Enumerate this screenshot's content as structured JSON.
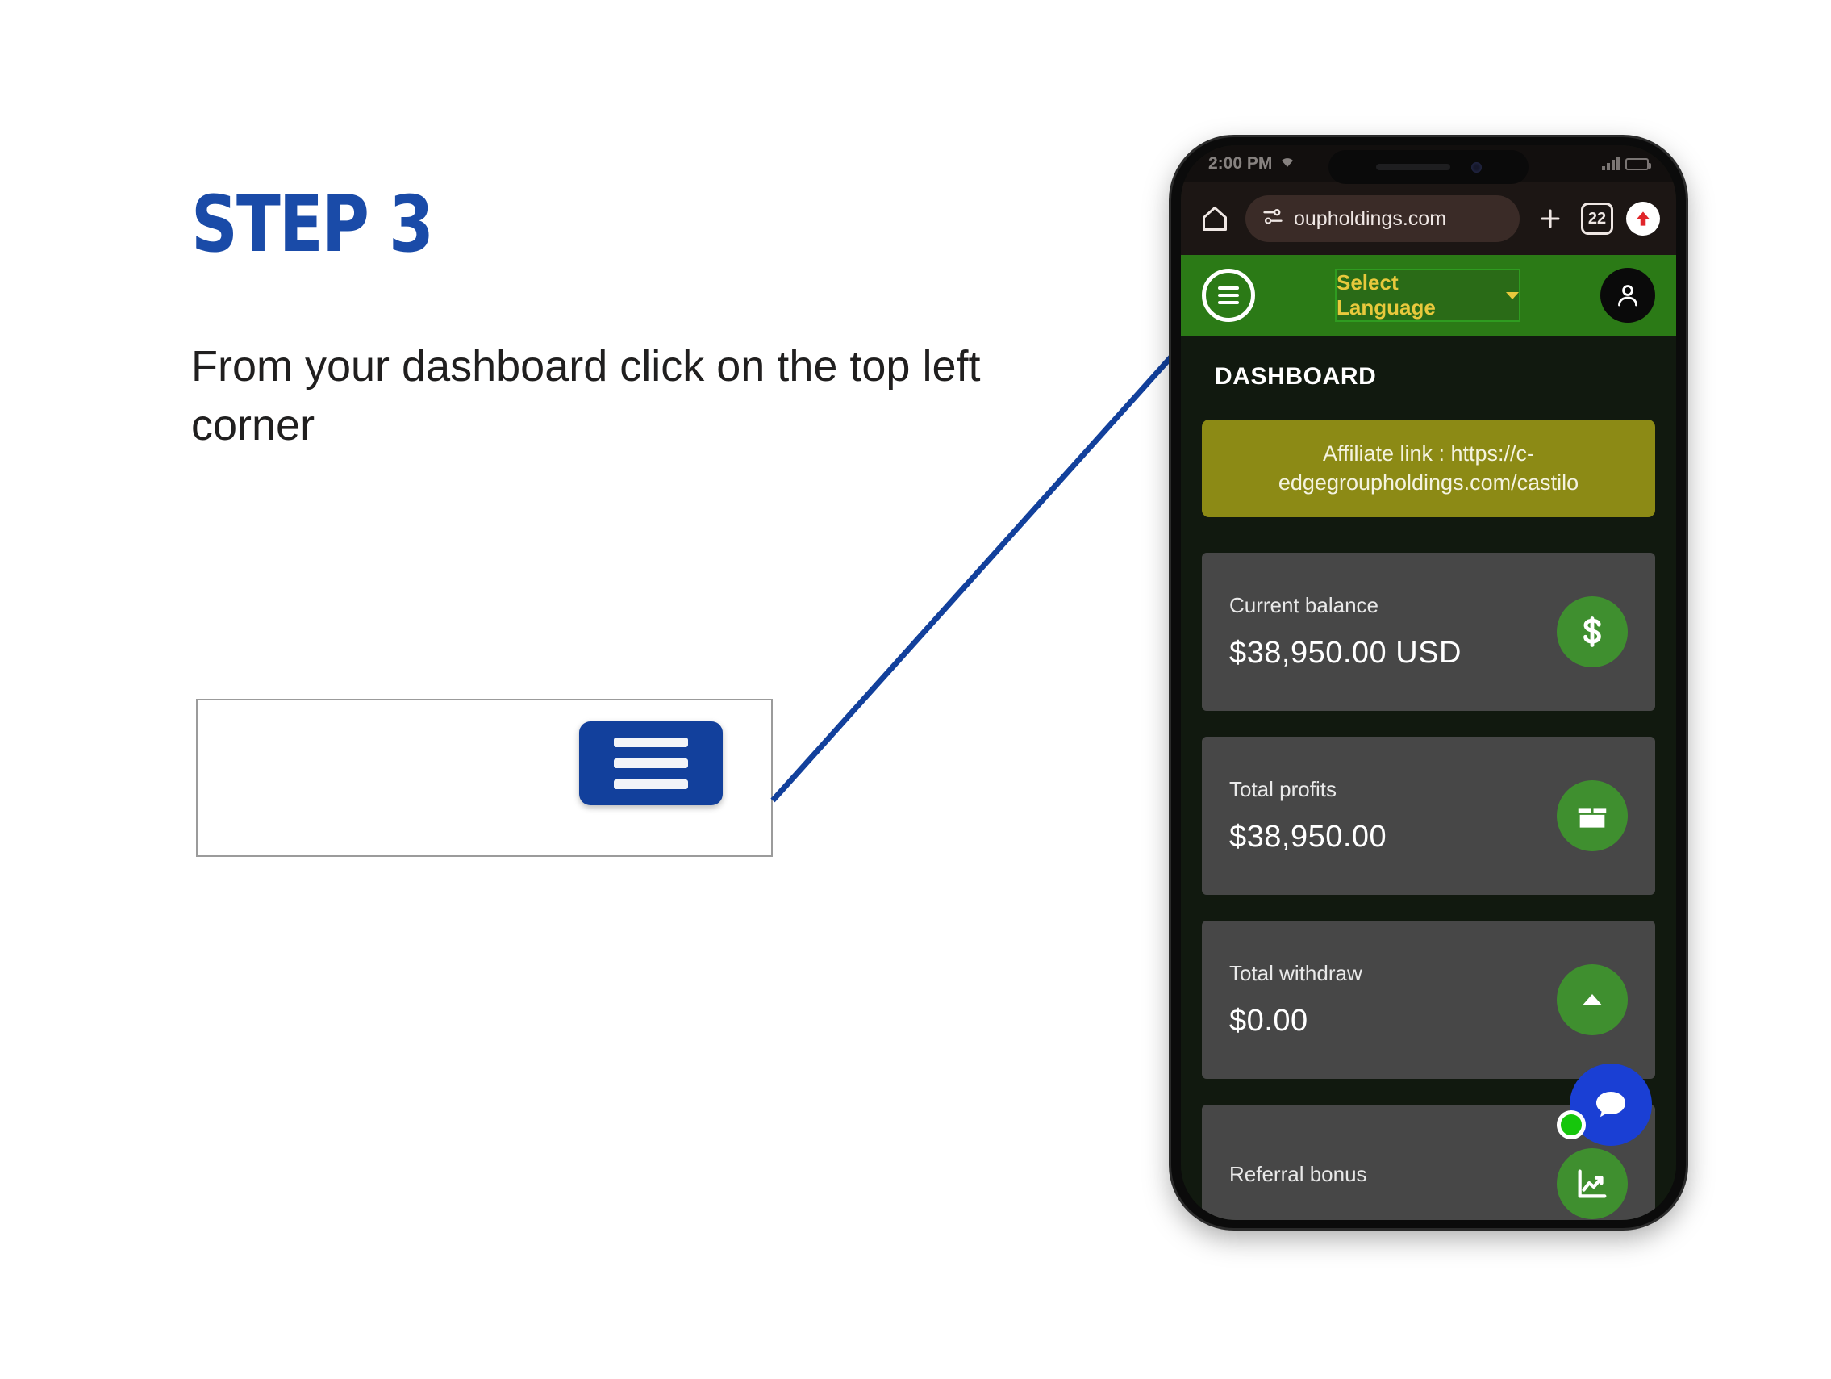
{
  "slide": {
    "step_title": "STEP 3",
    "instruction": "From your dashboard click on the top left corner",
    "accent_color": "#1a4ba8"
  },
  "callout": {
    "button_icon": "hamburger-menu-icon",
    "box_border_color": "#9b9b9b",
    "button_color": "#12409c"
  },
  "phone": {
    "status_bar": {
      "time": "2:00 PM",
      "wifi_icon": "wifi-icon",
      "signal_icon": "signal-bars-icon",
      "battery_icon": "battery-icon"
    },
    "browser": {
      "home_icon": "home-icon",
      "site_settings_icon": "tune-icon",
      "url": "oupholdings.com",
      "new_tab_icon": "plus-icon",
      "tab_count": "22",
      "share_icon": "share-upload-icon"
    },
    "app_header": {
      "menu_icon": "hamburger-menu-icon",
      "language_label": "Select Language",
      "language_chevron_icon": "chevron-down-icon",
      "avatar_icon": "user-account-icon",
      "bg_color": "#2b7a16",
      "accent_text_color": "#e8c93c"
    },
    "dashboard": {
      "page_title": "DASHBOARD",
      "affiliate_banner": "Affiliate link : https://c-edgegroupholdings.com/castilo",
      "banner_color": "#8c8a15",
      "cards": [
        {
          "label": "Current balance",
          "value": "$38,950.00 USD",
          "icon": "dollar-sign-icon"
        },
        {
          "label": "Total profits",
          "value": "$38,950.00",
          "icon": "box-package-icon"
        },
        {
          "label": "Total withdraw",
          "value": "$0.00",
          "icon": "arrow-up-icon"
        },
        {
          "label": "Referral bonus",
          "value": "",
          "icon": "line-chart-icon"
        }
      ]
    },
    "chat_widget": {
      "icon": "chat-bubble-icon",
      "status_icon": "online-status-dot",
      "color": "#1a3fd4",
      "status_color": "#16c60c"
    }
  }
}
